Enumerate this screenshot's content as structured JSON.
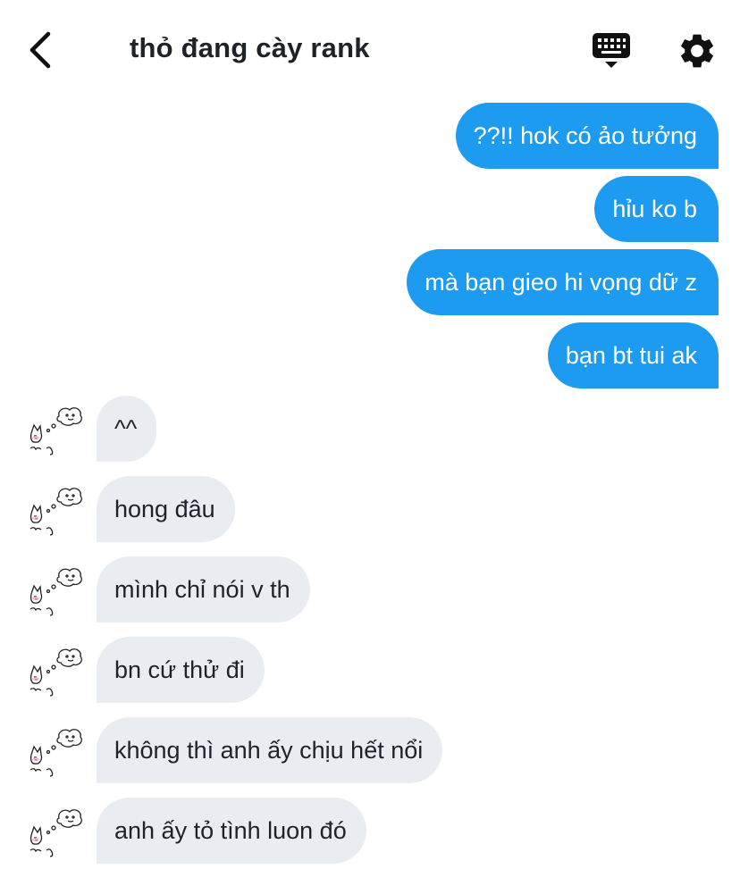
{
  "header": {
    "title": "thỏ đang cày rank"
  },
  "icons": {
    "back": "chevron-left-icon",
    "keyboard": "keyboard-icon",
    "settings": "gear-icon"
  },
  "colors": {
    "outgoing_bubble": "#1d9bf0",
    "incoming_bubble": "#e9ecf0"
  },
  "messages_out": [
    {
      "text": "??!! hok có ảo tưởng"
    },
    {
      "text": "hỉu ko b"
    },
    {
      "text": "mà bạn gieo hi vọng dữ z"
    },
    {
      "text": "bạn bt tui ak"
    }
  ],
  "messages_in": [
    {
      "text": "^^"
    },
    {
      "text": "hong đâu"
    },
    {
      "text": "mình chỉ nói v th"
    },
    {
      "text": "bn cứ thử đi"
    },
    {
      "text": "không thì anh ấy chịu hết nổi"
    },
    {
      "text": "anh ấy tỏ tình luon đó"
    }
  ]
}
